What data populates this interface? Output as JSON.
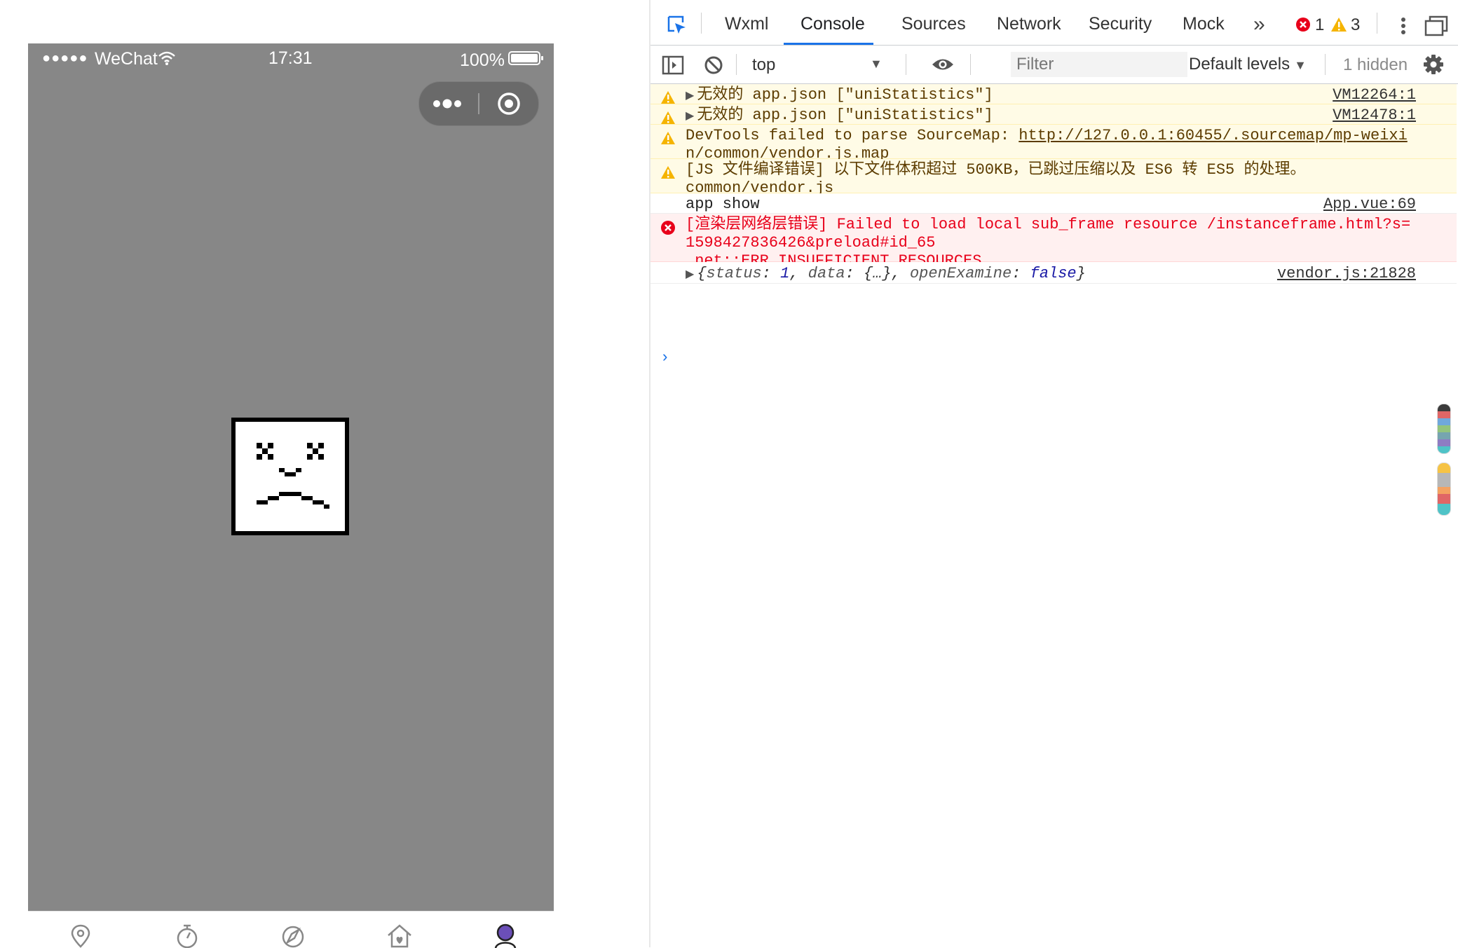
{
  "simulator": {
    "status_bar": {
      "signal": "●●●●●",
      "carrier": "WeChat",
      "time": "17:31",
      "battery": "100%"
    },
    "capsule": {
      "more_icon": "more-dots-icon",
      "close_icon": "target-circle-icon"
    },
    "error_icon": "sad-face-icon",
    "tabbar_icons": [
      "location-pin-icon",
      "timer-icon",
      "compass-icon",
      "home-heart-icon",
      "profile-icon"
    ]
  },
  "devtools": {
    "tabs": [
      {
        "label": "Wxml"
      },
      {
        "label": "Console"
      },
      {
        "label": "Sources"
      },
      {
        "label": "Network"
      },
      {
        "label": "Security"
      },
      {
        "label": "Mock"
      }
    ],
    "active_tab": "Console",
    "more_tabs": "»",
    "error_count": "1",
    "warning_count": "3",
    "toolbar": {
      "context": "top",
      "filter_placeholder": "Filter",
      "levels": "Default levels",
      "hidden": "1 hidden"
    },
    "messages": [
      {
        "level": "warning",
        "text": "无效的 app.json [\"uniStatistics\"]",
        "source": "VM12264:1"
      },
      {
        "level": "warning",
        "text": "无效的 app.json [\"uniStatistics\"]",
        "source": "VM12478:1"
      },
      {
        "level": "warning",
        "text_prefix": "DevTools failed to parse SourceMap: ",
        "link": "http://127.0.0.1:60455/.sourcemap/mp-weixin/common/vendor.js.map"
      },
      {
        "level": "warning",
        "text": "[JS 文件编译错误] 以下文件体积超过 500KB，已跳过压缩以及 ES6 转 ES5 的处理。\ncommon/vendor.js"
      },
      {
        "level": "log",
        "text": "app show",
        "source": "App.vue:69"
      },
      {
        "level": "error",
        "text": "[渲染层网络层错误] Failed to load local sub_frame resource /instanceframe.html?s=1598427836426&preload#id_65\n net::ERR_INSUFFICIENT_RESOURCES"
      },
      {
        "level": "log",
        "object": {
          "open": "{",
          "k1": "status",
          "v1": "1",
          "k2": "data",
          "v2": "{…}",
          "k3": "openExamine",
          "v3": "false",
          "close": "}"
        },
        "source": "vendor.js:21828"
      }
    ],
    "prompt": "›",
    "colors": {
      "accent": "#1a73e8",
      "warning_bg": "#fffbe6",
      "error_bg": "#fff0f0",
      "error_text": "#e8001a",
      "simulator_bg": "#878787"
    }
  }
}
